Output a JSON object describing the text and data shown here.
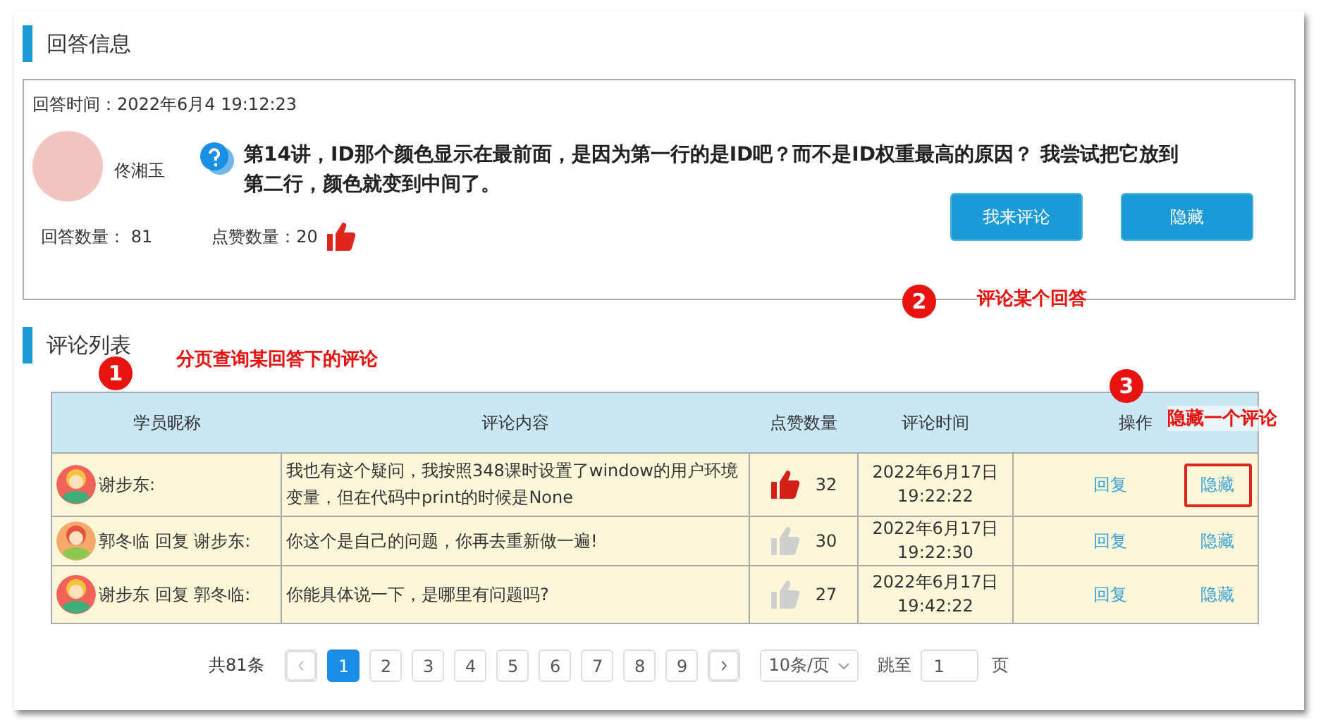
{
  "answer_section": {
    "title": "回答信息",
    "answer_time": "回答时间：2022年6月4 19:12:23",
    "author": "佟湘玉",
    "question": "第14讲，ID那个颜色显示在最前面，是因为第一行的是ID吧？而不是ID权重最高的原因？ 我尝试把它放到第二行，颜色就变到中间了。",
    "answer_count_label": "回答数量：",
    "answer_count": "81",
    "like_count_label": "点赞数量：",
    "like_count": "20",
    "buttons": [
      "我来评论",
      "隐藏"
    ]
  },
  "comments_section": {
    "title": "评论列表",
    "table": {
      "columns": [
        "学员昵称",
        "评论内容",
        "点赞数量",
        "评论时间",
        "操作"
      ],
      "rows": [
        {
          "avatar": {
            "kind": "blond"
          },
          "nickname": "谢步东:",
          "content": "我也有这个疑问，我按照348课时设置了window的用户环境变量，但在代码中print的时候是None",
          "liked": true,
          "likes": "32",
          "date": "2022年6月17日",
          "time": "19:22:22",
          "reply": "回复",
          "hide": "隐藏",
          "highlighted": true
        },
        {
          "avatar": {
            "kind": "redhead"
          },
          "nickname": "郭冬临 回复 谢步东:",
          "content": "你这个是自己的问题，你再去重新做一遍!",
          "liked": false,
          "likes": "30",
          "date": "2022年6月17日",
          "time": "19:22:30",
          "reply": "回复",
          "hide": "隐藏",
          "highlighted": false
        },
        {
          "avatar": {
            "kind": "blond"
          },
          "nickname": "谢步东 回复 郭冬临:",
          "content": "你能具体说一下，是哪里有问题吗?",
          "liked": false,
          "likes": "27",
          "date": "2022年6月17日",
          "time": "19:42:22",
          "reply": "回复",
          "hide": "隐藏",
          "highlighted": false
        }
      ]
    },
    "pagination": {
      "total": "共81条",
      "pages": [
        {
          "label": "1",
          "selected": true
        },
        {
          "label": "2",
          "selected": false
        },
        {
          "label": "3",
          "selected": false
        },
        {
          "label": "4",
          "selected": false
        },
        {
          "label": "5",
          "selected": false
        },
        {
          "label": "6",
          "selected": false
        },
        {
          "label": "7",
          "selected": false
        },
        {
          "label": "8",
          "selected": false
        },
        {
          "label": "9",
          "selected": false
        }
      ],
      "page_size": "10条/页",
      "jump_label": "跳至",
      "jump_value": "1",
      "page_unit": "页"
    }
  },
  "annotations": [
    {
      "number": "1",
      "text": "分页查询某回答下的评论"
    },
    {
      "number": "2",
      "text": "评论某个回答"
    },
    {
      "number": "3",
      "text": "隐藏一个评论"
    }
  ]
}
